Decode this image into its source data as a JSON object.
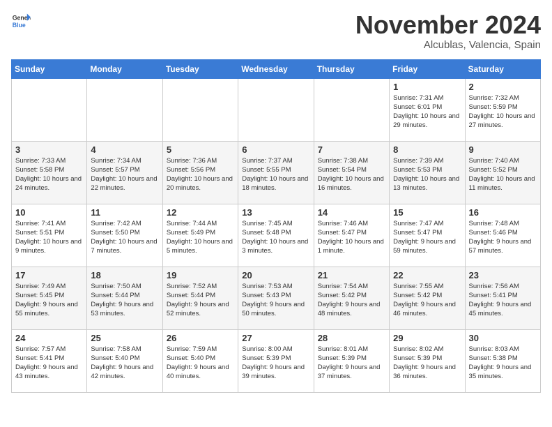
{
  "header": {
    "logo_general": "General",
    "logo_blue": "Blue",
    "title": "November 2024",
    "subtitle": "Alcublas, Valencia, Spain"
  },
  "weekdays": [
    "Sunday",
    "Monday",
    "Tuesday",
    "Wednesday",
    "Thursday",
    "Friday",
    "Saturday"
  ],
  "weeks": [
    [
      {
        "day": "",
        "info": ""
      },
      {
        "day": "",
        "info": ""
      },
      {
        "day": "",
        "info": ""
      },
      {
        "day": "",
        "info": ""
      },
      {
        "day": "",
        "info": ""
      },
      {
        "day": "1",
        "info": "Sunrise: 7:31 AM\nSunset: 6:01 PM\nDaylight: 10 hours and 29 minutes."
      },
      {
        "day": "2",
        "info": "Sunrise: 7:32 AM\nSunset: 5:59 PM\nDaylight: 10 hours and 27 minutes."
      }
    ],
    [
      {
        "day": "3",
        "info": "Sunrise: 7:33 AM\nSunset: 5:58 PM\nDaylight: 10 hours and 24 minutes."
      },
      {
        "day": "4",
        "info": "Sunrise: 7:34 AM\nSunset: 5:57 PM\nDaylight: 10 hours and 22 minutes."
      },
      {
        "day": "5",
        "info": "Sunrise: 7:36 AM\nSunset: 5:56 PM\nDaylight: 10 hours and 20 minutes."
      },
      {
        "day": "6",
        "info": "Sunrise: 7:37 AM\nSunset: 5:55 PM\nDaylight: 10 hours and 18 minutes."
      },
      {
        "day": "7",
        "info": "Sunrise: 7:38 AM\nSunset: 5:54 PM\nDaylight: 10 hours and 16 minutes."
      },
      {
        "day": "8",
        "info": "Sunrise: 7:39 AM\nSunset: 5:53 PM\nDaylight: 10 hours and 13 minutes."
      },
      {
        "day": "9",
        "info": "Sunrise: 7:40 AM\nSunset: 5:52 PM\nDaylight: 10 hours and 11 minutes."
      }
    ],
    [
      {
        "day": "10",
        "info": "Sunrise: 7:41 AM\nSunset: 5:51 PM\nDaylight: 10 hours and 9 minutes."
      },
      {
        "day": "11",
        "info": "Sunrise: 7:42 AM\nSunset: 5:50 PM\nDaylight: 10 hours and 7 minutes."
      },
      {
        "day": "12",
        "info": "Sunrise: 7:44 AM\nSunset: 5:49 PM\nDaylight: 10 hours and 5 minutes."
      },
      {
        "day": "13",
        "info": "Sunrise: 7:45 AM\nSunset: 5:48 PM\nDaylight: 10 hours and 3 minutes."
      },
      {
        "day": "14",
        "info": "Sunrise: 7:46 AM\nSunset: 5:47 PM\nDaylight: 10 hours and 1 minute."
      },
      {
        "day": "15",
        "info": "Sunrise: 7:47 AM\nSunset: 5:47 PM\nDaylight: 9 hours and 59 minutes."
      },
      {
        "day": "16",
        "info": "Sunrise: 7:48 AM\nSunset: 5:46 PM\nDaylight: 9 hours and 57 minutes."
      }
    ],
    [
      {
        "day": "17",
        "info": "Sunrise: 7:49 AM\nSunset: 5:45 PM\nDaylight: 9 hours and 55 minutes."
      },
      {
        "day": "18",
        "info": "Sunrise: 7:50 AM\nSunset: 5:44 PM\nDaylight: 9 hours and 53 minutes."
      },
      {
        "day": "19",
        "info": "Sunrise: 7:52 AM\nSunset: 5:44 PM\nDaylight: 9 hours and 52 minutes."
      },
      {
        "day": "20",
        "info": "Sunrise: 7:53 AM\nSunset: 5:43 PM\nDaylight: 9 hours and 50 minutes."
      },
      {
        "day": "21",
        "info": "Sunrise: 7:54 AM\nSunset: 5:42 PM\nDaylight: 9 hours and 48 minutes."
      },
      {
        "day": "22",
        "info": "Sunrise: 7:55 AM\nSunset: 5:42 PM\nDaylight: 9 hours and 46 minutes."
      },
      {
        "day": "23",
        "info": "Sunrise: 7:56 AM\nSunset: 5:41 PM\nDaylight: 9 hours and 45 minutes."
      }
    ],
    [
      {
        "day": "24",
        "info": "Sunrise: 7:57 AM\nSunset: 5:41 PM\nDaylight: 9 hours and 43 minutes."
      },
      {
        "day": "25",
        "info": "Sunrise: 7:58 AM\nSunset: 5:40 PM\nDaylight: 9 hours and 42 minutes."
      },
      {
        "day": "26",
        "info": "Sunrise: 7:59 AM\nSunset: 5:40 PM\nDaylight: 9 hours and 40 minutes."
      },
      {
        "day": "27",
        "info": "Sunrise: 8:00 AM\nSunset: 5:39 PM\nDaylight: 9 hours and 39 minutes."
      },
      {
        "day": "28",
        "info": "Sunrise: 8:01 AM\nSunset: 5:39 PM\nDaylight: 9 hours and 37 minutes."
      },
      {
        "day": "29",
        "info": "Sunrise: 8:02 AM\nSunset: 5:39 PM\nDaylight: 9 hours and 36 minutes."
      },
      {
        "day": "30",
        "info": "Sunrise: 8:03 AM\nSunset: 5:38 PM\nDaylight: 9 hours and 35 minutes."
      }
    ]
  ]
}
